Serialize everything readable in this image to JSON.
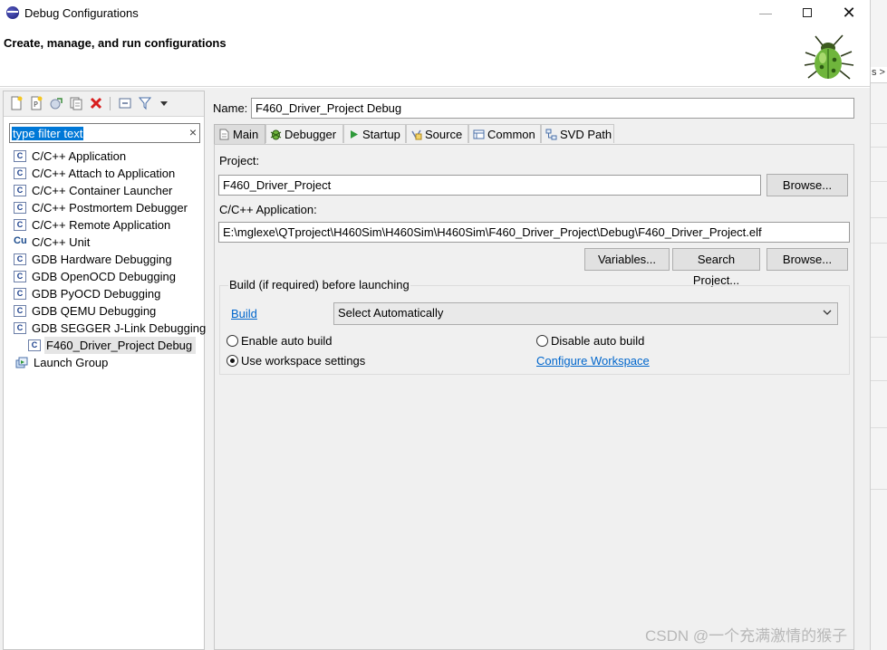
{
  "window": {
    "title": "Debug Configurations"
  },
  "header": {
    "title": "Create, manage, and run configurations"
  },
  "background_window": {
    "tab_label": "s >"
  },
  "left_panel": {
    "filter": {
      "value": "type filter text",
      "clear_icon": "×"
    },
    "tree": [
      {
        "label": "C/C++ Application",
        "icon": "c-file-icon",
        "glyph": "C"
      },
      {
        "label": "C/C++ Attach to Application",
        "icon": "c-file-icon",
        "glyph": "C"
      },
      {
        "label": "C/C++ Container Launcher",
        "icon": "c-file-icon",
        "glyph": "C"
      },
      {
        "label": "C/C++ Postmortem Debugger",
        "icon": "c-file-icon",
        "glyph": "C"
      },
      {
        "label": "C/C++ Remote Application",
        "icon": "c-file-icon",
        "glyph": "C"
      },
      {
        "label": "C/C++ Unit",
        "icon": "c-unit-icon",
        "glyph": "Cu"
      },
      {
        "label": "GDB Hardware Debugging",
        "icon": "c-file-icon",
        "glyph": "C"
      },
      {
        "label": "GDB OpenOCD Debugging",
        "icon": "c-file-icon",
        "glyph": "C"
      },
      {
        "label": "GDB PyOCD Debugging",
        "icon": "c-file-icon",
        "glyph": "C"
      },
      {
        "label": "GDB QEMU Debugging",
        "icon": "c-file-icon",
        "glyph": "C"
      },
      {
        "label": "GDB SEGGER J-Link Debugging",
        "icon": "c-file-icon",
        "glyph": "C"
      },
      {
        "label": "F460_Driver_Project Debug",
        "icon": "c-file-icon",
        "glyph": "C",
        "selected": true
      },
      {
        "label": "Launch Group",
        "icon": "launch-group-icon",
        "glyph": ""
      }
    ]
  },
  "right_panel": {
    "name_label": "Name:",
    "name_value": "F460_Driver_Project Debug",
    "tabs": [
      {
        "label": "Main",
        "icon": "main-tab-icon",
        "active": true
      },
      {
        "label": "Debugger",
        "icon": "debugger-tab-icon"
      },
      {
        "label": "Startup",
        "icon": "startup-tab-icon"
      },
      {
        "label": "Source",
        "icon": "source-tab-icon"
      },
      {
        "label": "Common",
        "icon": "common-tab-icon"
      },
      {
        "label": "SVD Path",
        "icon": "svd-path-tab-icon"
      }
    ],
    "project_label": "Project:",
    "project_value": "F460_Driver_Project",
    "browse_label": "Browse...",
    "application_label": "C/C++ Application:",
    "application_value": "E:\\mglexe\\QTproject\\H460Sim\\H460Sim\\H460Sim\\F460_Driver_Project\\Debug\\F460_Driver_Project.elf",
    "variables_label": "Variables...",
    "search_project_label": "Search Project...",
    "build_group": {
      "title": "Build (if required) before launching",
      "build_link": "Build",
      "select_value": "Select Automatically",
      "enable_auto_build": "Enable auto build",
      "disable_auto_build": "Disable auto build",
      "use_workspace_settings": "Use workspace settings",
      "configure_workspace": "Configure Workspace",
      "selected_option": "use_workspace_settings"
    }
  },
  "watermark": "CSDN @一个充满激情的猴子",
  "colors": {
    "selection": "#0078d7",
    "link": "#0066cc",
    "panel": "#f0f0f0"
  }
}
